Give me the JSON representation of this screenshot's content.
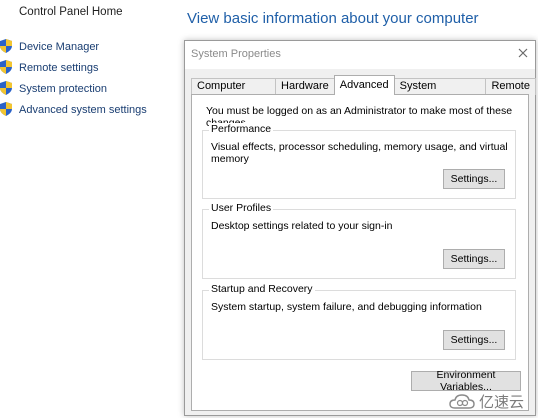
{
  "control_panel": {
    "home_link": "Control Panel Home",
    "nav_items": [
      {
        "label": "Device Manager",
        "icon": "shield-icon"
      },
      {
        "label": "Remote settings",
        "icon": "shield-icon"
      },
      {
        "label": "System protection",
        "icon": "shield-icon"
      },
      {
        "label": "Advanced system settings",
        "icon": "shield-icon"
      }
    ],
    "heading": "View basic information about your computer"
  },
  "dialog": {
    "title": "System Properties",
    "close_icon": "close-icon",
    "tabs": [
      {
        "label": "Computer Name",
        "active": false
      },
      {
        "label": "Hardware",
        "active": false
      },
      {
        "label": "Advanced",
        "active": true
      },
      {
        "label": "System Protection",
        "active": false
      },
      {
        "label": "Remote",
        "active": false
      }
    ],
    "admin_note": "You must be logged on as an Administrator to make most of these changes.",
    "groups": {
      "performance": {
        "title": "Performance",
        "description": "Visual effects, processor scheduling, memory usage, and virtual memory",
        "button": "Settings..."
      },
      "user_profiles": {
        "title": "User Profiles",
        "description": "Desktop settings related to your sign-in",
        "button": "Settings..."
      },
      "startup_recovery": {
        "title": "Startup and Recovery",
        "description": "System startup, system failure, and debugging information",
        "button": "Settings..."
      }
    },
    "env_button": "Environment Variables..."
  },
  "watermark": {
    "text": "亿速云"
  },
  "colors": {
    "link": "#1a3e72",
    "heading": "#1f5fa8",
    "dialog_bg": "#f0f0f0",
    "panel_bg": "#ffffff",
    "button_bg": "#e1e1e1"
  }
}
